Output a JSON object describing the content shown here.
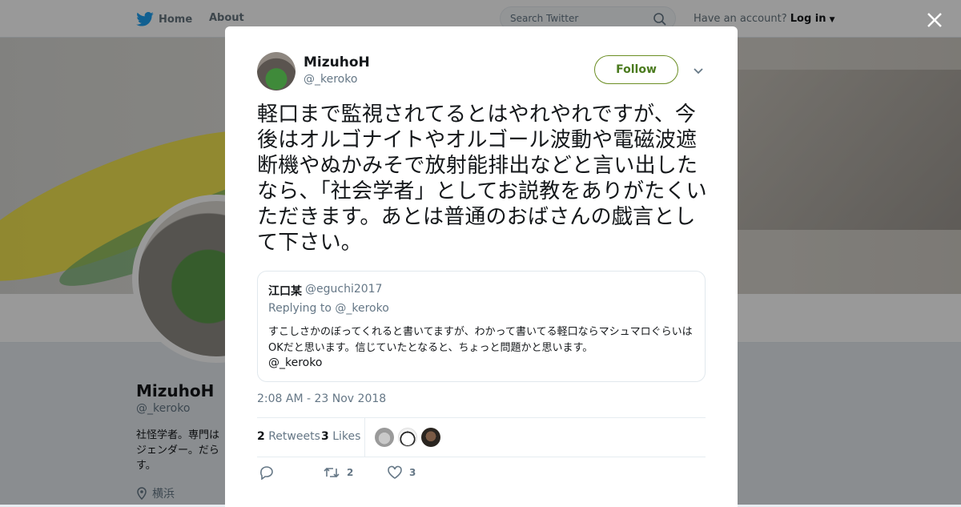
{
  "topnav": {
    "home_label": "Home",
    "about_label": "About",
    "search_placeholder": "Search Twitter",
    "account_prompt": "Have an account?",
    "login_label": "Log in"
  },
  "profile": {
    "name": "MizuhoH",
    "handle": "@_keroko",
    "bio": "社怪学者。専門は ジェンダー。だら す。",
    "location": "横浜"
  },
  "tweet": {
    "author_name": "MizuhoH",
    "author_handle": "@_keroko",
    "follow_label": "Follow",
    "text": "軽口まで監視されてるとはやれやれですが、今後はオルゴナイトやオルゴール波動や電磁波遮断機やぬかみそで放射能排出などと言い出したなら、「社会学者」としてお説教をありがたくいただきます。あとは普通のおばさんの戯言として下さい。",
    "timestamp": "2:08 AM - 23 Nov 2018",
    "retweets_count": "2",
    "retweets_label": "Retweets",
    "likes_count": "3",
    "likes_label": "Likes",
    "actions": {
      "retweet_count": "2",
      "like_count": "3"
    }
  },
  "quoted": {
    "name": "江口某",
    "handle": "@eguchi2017",
    "replying_to": "Replying to @_keroko",
    "text": "すこしさかのぼってくれると書いてますが、わかって書いてる軽口ならマシュマロぐらいはOKだと思います。信じていたとなると、ちょっと問題かと思います。",
    "mention": "@_keroko"
  },
  "colors": {
    "twitter_blue": "#1da1f2",
    "follow_border": "#6b8e23"
  }
}
